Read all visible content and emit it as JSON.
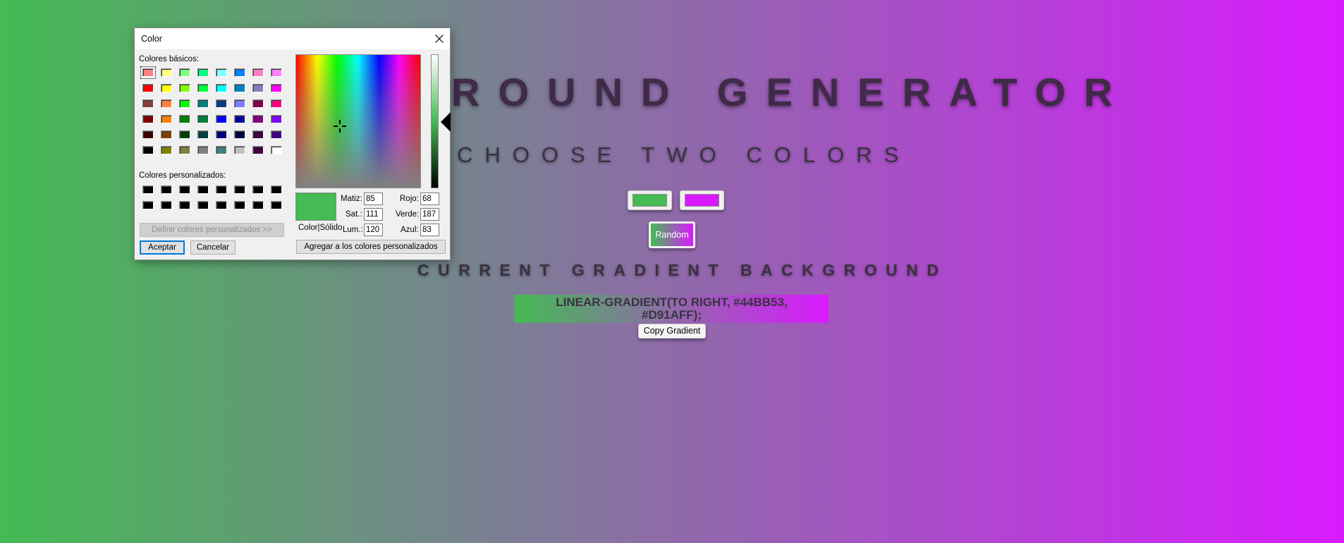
{
  "page": {
    "title": "ROUND GENERATOR",
    "subtitle": "CHOOSE TWO COLORS",
    "color1": "#44bb53",
    "color2": "#d91aff",
    "random_label": "Random",
    "section_heading": "CURRENT GRADIENT BACKGROUND",
    "gradient_css": "LINEAR-GRADIENT(TO RIGHT, #44BB53, #D91AFF);",
    "copy_label": "Copy Gradient"
  },
  "dialog": {
    "title": "Color",
    "close_icon": "close-icon",
    "basic_colors_label": "Colores básicos:",
    "basic_colors": [
      "#ff8080",
      "#ffff80",
      "#80ff80",
      "#00ff80",
      "#80ffff",
      "#0080ff",
      "#ff80c0",
      "#ff80ff",
      "#ff0000",
      "#ffff00",
      "#80ff00",
      "#00ff40",
      "#00ffff",
      "#0080c0",
      "#8080c0",
      "#ff00ff",
      "#804040",
      "#ff8040",
      "#00ff00",
      "#008080",
      "#004080",
      "#8080ff",
      "#800040",
      "#ff0080",
      "#800000",
      "#ff8000",
      "#008000",
      "#008040",
      "#0000ff",
      "#0000a0",
      "#800080",
      "#8000ff",
      "#400000",
      "#804000",
      "#004000",
      "#004040",
      "#000080",
      "#000040",
      "#400040",
      "#400080",
      "#000000",
      "#808000",
      "#808040",
      "#808080",
      "#408080",
      "#c0c0c0",
      "#400040",
      "#ffffff"
    ],
    "custom_colors_label": "Colores personalizados:",
    "custom_colors": [
      "#000000",
      "#000000",
      "#000000",
      "#000000",
      "#000000",
      "#000000",
      "#000000",
      "#000000",
      "#000000",
      "#000000",
      "#000000",
      "#000000",
      "#000000",
      "#000000",
      "#000000",
      "#000000"
    ],
    "define_custom_label": "Definir colores personalizados >>",
    "ok_label": "Aceptar",
    "cancel_label": "Cancelar",
    "add_custom_label": "Agregar a los colores personalizados",
    "color_solid_label": "Color|Sólido",
    "hue_label": "Matiz:",
    "hue_value": "85",
    "sat_label": "Sat.:",
    "sat_value": "111",
    "lum_label": "Lum.:",
    "lum_value": "120",
    "red_label": "Rojo:",
    "red_value": "68",
    "green_label": "Verde:",
    "green_value": "187",
    "blue_label": "Azul:",
    "blue_value": "83",
    "preview_color": "#44bb53"
  }
}
